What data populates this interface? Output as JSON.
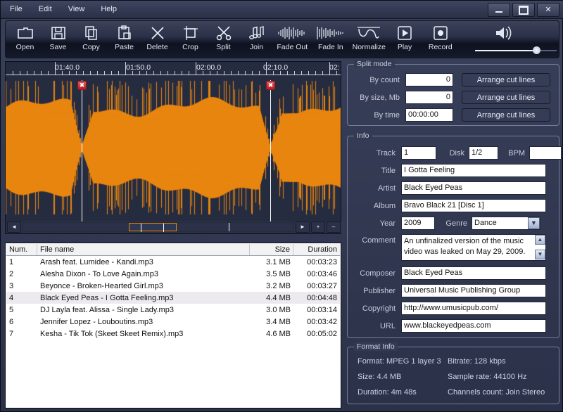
{
  "window": {
    "menu": [
      "File",
      "Edit",
      "View",
      "Help"
    ],
    "controls": {
      "minimize": "–",
      "maximize": "❐",
      "close": "✕"
    }
  },
  "toolbar": {
    "buttons": [
      {
        "label": "Open",
        "icon": "folder-open-icon"
      },
      {
        "label": "Save",
        "icon": "floppy-disk-icon"
      },
      {
        "label": "Copy",
        "icon": "copy-pages-icon"
      },
      {
        "label": "Paste",
        "icon": "clipboard-icon"
      },
      {
        "label": "Delete",
        "icon": "x-cross-icon"
      },
      {
        "label": "Crop",
        "icon": "crop-icon"
      },
      {
        "label": "Split",
        "icon": "scissors-icon"
      },
      {
        "label": "Join",
        "icon": "music-notes-icon"
      },
      {
        "label": "Fade Out",
        "icon": "fade-out-wave-icon"
      },
      {
        "label": "Fade In",
        "icon": "fade-in-wave-icon"
      },
      {
        "label": "Normalize",
        "icon": "normalize-wave-icon"
      },
      {
        "label": "Play",
        "icon": "play-triangle-icon"
      },
      {
        "label": "Record",
        "icon": "record-dot-icon"
      }
    ],
    "volume": {
      "icon": "speaker-icon",
      "value": 76
    }
  },
  "waveform": {
    "ruler_labels": [
      "01:40.0",
      "01:50.0",
      "02:00.0",
      "02:10.0",
      "02:"
    ],
    "cut_markers": [
      {
        "position_pct": 22.8,
        "icon": "red-x-marker"
      },
      {
        "position_pct": 78.2,
        "icon": "red-x-marker"
      }
    ],
    "scroll": {
      "left_arrow": "◄",
      "right_arrow": "►",
      "zoom_in": "+",
      "zoom_out": "–"
    }
  },
  "file_list": {
    "columns": [
      "Num.",
      "File name",
      "Size",
      "Duration"
    ],
    "selected_row": 4,
    "rows": [
      {
        "num": "1",
        "name": "Arash feat. Lumidee - Kandi.mp3",
        "size": "3.1 MB",
        "duration": "00:03:23"
      },
      {
        "num": "2",
        "name": "Alesha Dixon - To Love Again.mp3",
        "size": "3.5 MB",
        "duration": "00:03:46"
      },
      {
        "num": "3",
        "name": "Beyonce - Broken-Hearted Girl.mp3",
        "size": "3.2 MB",
        "duration": "00:03:27"
      },
      {
        "num": "4",
        "name": "Black Eyed Peas - I Gotta Feeling.mp3",
        "size": "4.4 MB",
        "duration": "00:04:48"
      },
      {
        "num": "5",
        "name": "DJ Layla feat. Alissa - Single Lady.mp3",
        "size": "3.0 MB",
        "duration": "00:03:14"
      },
      {
        "num": "6",
        "name": "Jennifer Lopez - Louboutins.mp3",
        "size": "3.4 MB",
        "duration": "00:03:42"
      },
      {
        "num": "7",
        "name": "Kesha - Tik Tok (Skeet Skeet Remix).mp3",
        "size": "4.6 MB",
        "duration": "00:05:02"
      }
    ]
  },
  "split_mode": {
    "legend": "Split mode",
    "by_count_label": "By count",
    "by_count_value": "0",
    "by_size_label": "By size, Mb",
    "by_size_value": "0",
    "by_time_label": "By time",
    "by_time_value": "00:00:00",
    "button_label": "Arrange cut lines"
  },
  "info": {
    "legend": "Info",
    "track_label": "Track",
    "track_value": "1",
    "disk_label": "Disk",
    "disk_value": "1/2",
    "bpm_label": "BPM",
    "bpm_value": "",
    "title_label": "Title",
    "title_value": "I Gotta Feeling",
    "artist_label": "Artist",
    "artist_value": "Black Eyed Peas",
    "album_label": "Album",
    "album_value": "Bravo Black 21 [Disc 1]",
    "year_label": "Year",
    "year_value": "2009",
    "genre_label": "Genre",
    "genre_value": "Dance",
    "comment_label": "Comment",
    "comment_value": "An unfinalized version of the music video was leaked on May 29, 2009.",
    "composer_label": "Composer",
    "composer_value": "Black Eyed Peas",
    "publisher_label": "Publisher",
    "publisher_value": "Universal Music Publishing Group",
    "copyright_label": "Copyright",
    "copyright_value": "http://www.umusicpub.com/",
    "url_label": "URL",
    "url_value": "www.blackeyedpeas.com"
  },
  "format_info": {
    "legend": "Format Info",
    "format": "Format: MPEG 1 layer 3",
    "bitrate": "Bitrate: 128 kbps",
    "size": "Size: 4.4 MB",
    "sample_rate": "Sample rate: 44100 Hz",
    "duration": "Duration: 4m 48s",
    "channels": "Channels count: Join Stereo"
  },
  "colors": {
    "waveform": "#e8850f",
    "panel_bg": "#343a52",
    "accent": "#e8860f",
    "delete_red": "#b22026"
  }
}
